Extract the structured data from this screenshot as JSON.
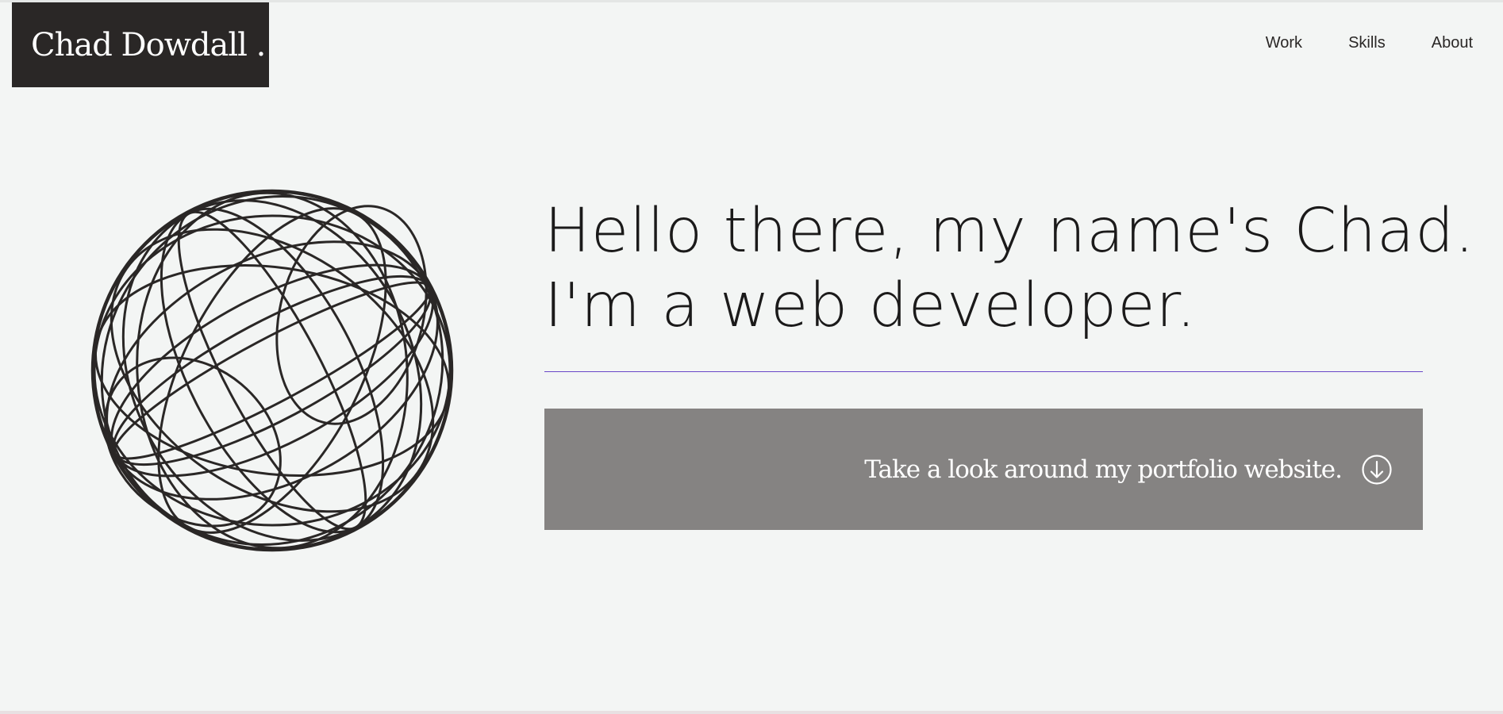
{
  "site": {
    "logo": "Chad Dowdall ."
  },
  "nav": {
    "items": [
      {
        "label": "Work"
      },
      {
        "label": "Skills"
      },
      {
        "label": "About"
      }
    ]
  },
  "hero": {
    "line1": "Hello there, my name's Chad.",
    "line2": "I'm a web developer.",
    "cta_label": "Take a look around my portfolio website.",
    "cta_icon": "arrow-down-circle-icon",
    "graphic": "wireframe-globe"
  },
  "colors": {
    "background": "#f3f5f4",
    "logo_bg": "#2a2726",
    "divider": "#6a47c8",
    "cta_bg": "#858382"
  }
}
